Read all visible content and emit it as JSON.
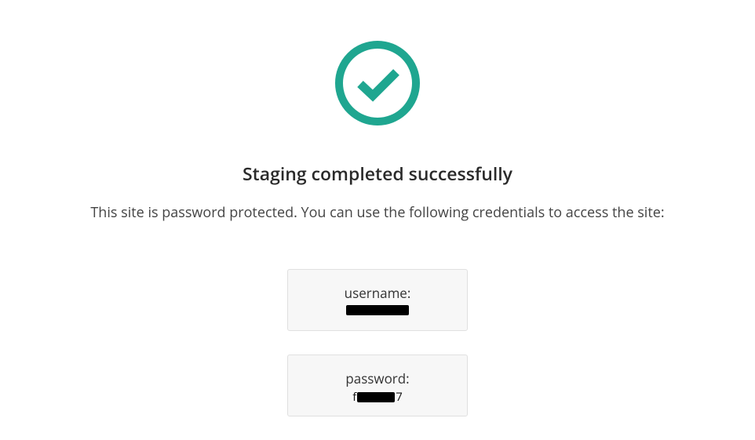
{
  "status": {
    "title": "Staging completed successfully",
    "message": "This site is password protected. You can use the following credentials to access the site:"
  },
  "credentials": {
    "username_label": "username:",
    "username_value": "[redacted]",
    "password_label": "password:",
    "password_value_prefix": "f",
    "password_value_suffix": "7"
  },
  "colors": {
    "accent": "#1fa690"
  }
}
